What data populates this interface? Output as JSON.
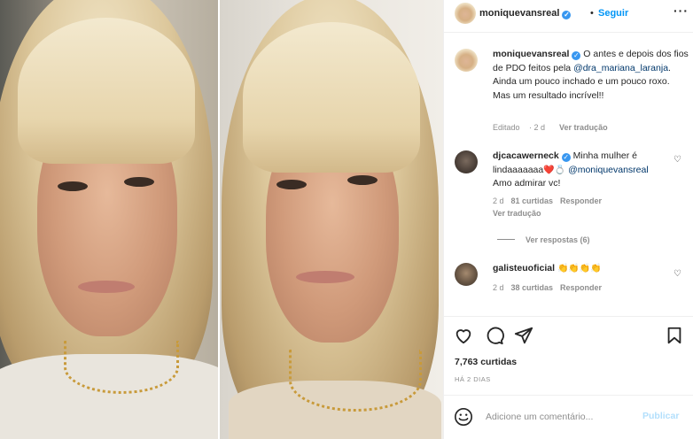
{
  "post": {
    "username": "moniquevansreal",
    "follow_label": "Seguir",
    "more_icon": "more-horizontal-icon"
  },
  "caption": {
    "username": "moniquevansreal",
    "text_before_mention": "O antes e depois dos fios de PDO feitos pela",
    "mention": "@dra_mariana_laranja",
    "text_after_mention": ". Ainda um pouco inchado e um pouco roxo. Mas um resultado incrível!!",
    "edited_label": "Editado",
    "age": "2 d",
    "translate_label": "Ver tradução"
  },
  "comments": [
    {
      "username": "djcacawerneck",
      "text_line1": "Minha mulher é",
      "text_line2": "lindaaaaaaa",
      "emoji": "❤️💍",
      "mention": "@moniquevansreal",
      "text_after_mention": "Amo admirar vc!",
      "age": "2 d",
      "likes_label": "81 curtidas",
      "reply_label": "Responder",
      "translate_label": "Ver tradução",
      "view_replies_label": "Ver respostas (6)"
    },
    {
      "username": "galisteuoficial",
      "emoji": "👏👏👏👏",
      "age": "2 d",
      "likes_label": "38 curtidas",
      "reply_label": "Responder"
    }
  ],
  "actions": {
    "like_icon": "heart-icon",
    "comment_icon": "comment-icon",
    "share_icon": "share-icon",
    "save_icon": "bookmark-icon"
  },
  "likes_label": "7,763 curtidas",
  "time_label": "HÁ 2 DIAS",
  "comment_box": {
    "placeholder": "Adicione um comentário...",
    "publish_label": "Publicar"
  },
  "colors": {
    "link": "#00376b",
    "follow_blue": "#0095f6",
    "publish_disabled": "#b2dffc",
    "verified": "#3897f0",
    "muted": "#8e8e8e"
  }
}
